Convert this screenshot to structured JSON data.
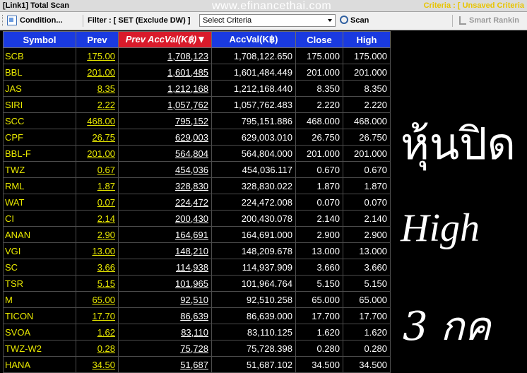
{
  "titlebar": {
    "title": "[Link1] Total Scan",
    "watermark": "www.efinancethai.com",
    "criteria": "Criteria : [ Unsaved Criteria"
  },
  "toolbar": {
    "condition_label": "Condition...",
    "filter_label": "Filter : [ SET (Exclude DW) ]",
    "select_value": "Select Criteria",
    "scan_label": "Scan",
    "smart_label": "Smart Rankin"
  },
  "table": {
    "headers": [
      "Symbol",
      "Prev",
      "Prev AccVal(K฿)",
      "AccVal(K฿)",
      "Close",
      "High"
    ],
    "sorted_column": "Prev AccVal(K฿)",
    "rows": [
      [
        "SCB",
        "175.00",
        "1,708,123",
        "1,708,122.650",
        "175.000",
        "175.000"
      ],
      [
        "BBL",
        "201.00",
        "1,601,485",
        "1,601,484.449",
        "201.000",
        "201.000"
      ],
      [
        "JAS",
        "8.35",
        "1,212,168",
        "1,212,168.440",
        "8.350",
        "8.350"
      ],
      [
        "SIRI",
        "2.22",
        "1,057,762",
        "1,057,762.483",
        "2.220",
        "2.220"
      ],
      [
        "SCC",
        "468.00",
        "795,152",
        "795,151.886",
        "468.000",
        "468.000"
      ],
      [
        "CPF",
        "26.75",
        "629,003",
        "629,003.010",
        "26.750",
        "26.750"
      ],
      [
        "BBL-F",
        "201.00",
        "564,804",
        "564,804.000",
        "201.000",
        "201.000"
      ],
      [
        "TWZ",
        "0.67",
        "454,036",
        "454,036.117",
        "0.670",
        "0.670"
      ],
      [
        "RML",
        "1.87",
        "328,830",
        "328,830.022",
        "1.870",
        "1.870"
      ],
      [
        "WAT",
        "0.07",
        "224,472",
        "224,472.008",
        "0.070",
        "0.070"
      ],
      [
        "CI",
        "2.14",
        "200,430",
        "200,430.078",
        "2.140",
        "2.140"
      ],
      [
        "ANAN",
        "2.90",
        "164,691",
        "164,691.000",
        "2.900",
        "2.900"
      ],
      [
        "VGI",
        "13.00",
        "148,210",
        "148,209.678",
        "13.000",
        "13.000"
      ],
      [
        "SC",
        "3.66",
        "114,938",
        "114,937.909",
        "3.660",
        "3.660"
      ],
      [
        "TSR",
        "5.15",
        "101,965",
        "101,964.764",
        "5.150",
        "5.150"
      ],
      [
        "M",
        "65.00",
        "92,510",
        "92,510.258",
        "65.000",
        "65.000"
      ],
      [
        "TICON",
        "17.70",
        "86,639",
        "86,639.000",
        "17.700",
        "17.700"
      ],
      [
        "SVOA",
        "1.62",
        "83,110",
        "83,110.125",
        "1.620",
        "1.620"
      ],
      [
        "TWZ-W2",
        "0.28",
        "75,728",
        "75,728.398",
        "0.280",
        "0.280"
      ],
      [
        "HANA",
        "34.50",
        "51,687",
        "51,687.102",
        "34.500",
        "34.500"
      ]
    ]
  },
  "overlay": {
    "line1": "หุ้นปิด",
    "line2": "High",
    "line3": "3 กค"
  },
  "colors": {
    "header_bg": "#1a3ae0",
    "sorted_header_bg": "#d91b2b",
    "symbol_text": "#e8e800",
    "grid_bg": "#000000"
  }
}
